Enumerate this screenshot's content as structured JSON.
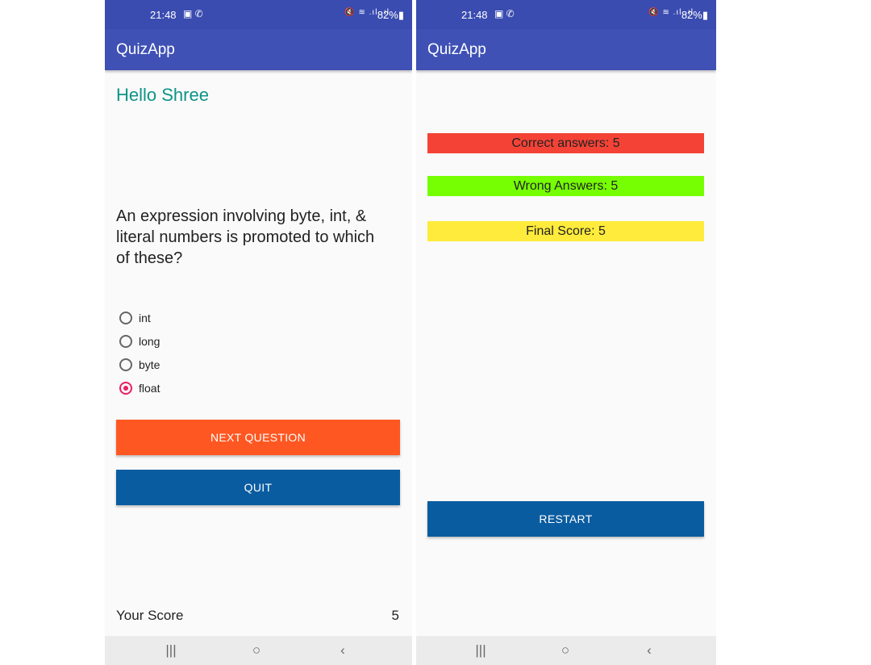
{
  "status_bar": {
    "time": "21:48",
    "battery": "82%"
  },
  "app": {
    "title": "QuizApp"
  },
  "quiz": {
    "greeting": "Hello Shree",
    "question": "An expression involving byte, int, & literal numbers is promoted to which of these?",
    "options": [
      {
        "label": "int",
        "selected": false
      },
      {
        "label": "long",
        "selected": false
      },
      {
        "label": "byte",
        "selected": false
      },
      {
        "label": "float",
        "selected": true
      }
    ],
    "next_label": "NEXT QUESTION",
    "quit_label": "QUIT",
    "score_label": "Your Score",
    "score_value": "5"
  },
  "result": {
    "correct": "Correct answers: 5",
    "wrong": "Wrong Answers: 5",
    "final": "Final Score: 5",
    "restart_label": "RESTART"
  },
  "nav": {
    "recents": "|||",
    "home": "○",
    "back": "‹"
  },
  "colors": {
    "status_bar": "#3a4cb0",
    "app_bar": "#3f51b5",
    "greeting_text": "#0c9488",
    "radio_checked": "#e91e63",
    "next_button": "#ff5722",
    "quit_button": "#0a5ca0",
    "restart_button": "#0a5ca0",
    "correct_bar": "#f44336",
    "wrong_bar": "#76ff03",
    "final_bar": "#ffeb3b"
  }
}
